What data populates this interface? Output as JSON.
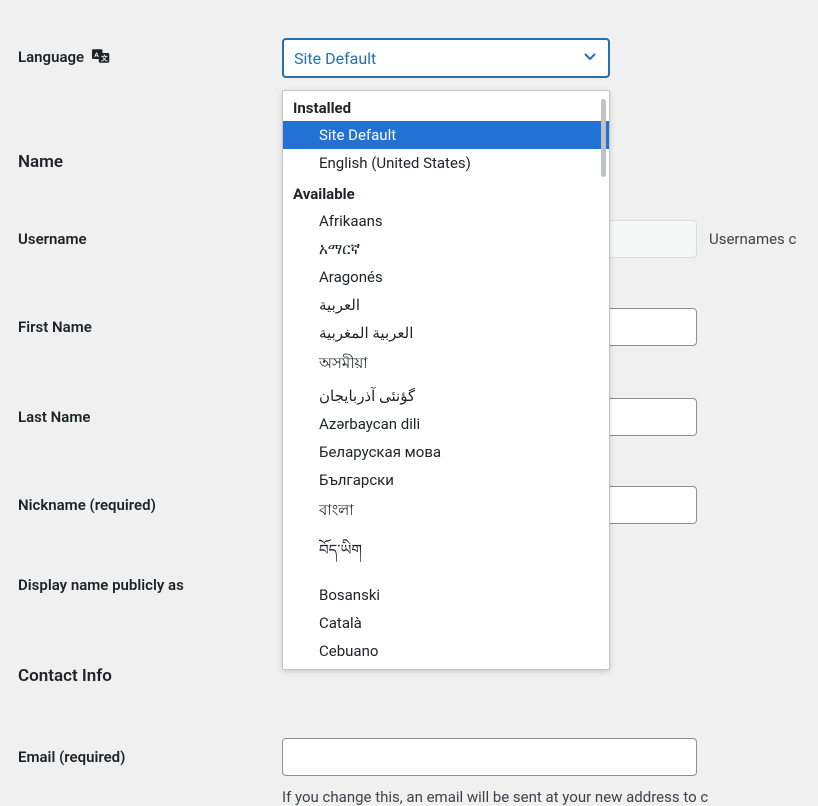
{
  "labels": {
    "language": "Language",
    "name": "Name",
    "username": "Username",
    "first_name": "First Name",
    "last_name": "Last Name",
    "nickname": "Nickname (required)",
    "display_name": "Display name publicly as",
    "contact_info": "Contact Info",
    "email": "Email (required)"
  },
  "language_select": {
    "current": "Site Default",
    "groups": [
      {
        "label": "Installed",
        "items": [
          "Site Default",
          "English (United States)"
        ]
      },
      {
        "label": "Available",
        "items": [
          "Afrikaans",
          "አማርኛ",
          "Aragonés",
          "العربية",
          "العربية المغربية",
          "অসমীয়া",
          "گؤنئی آذربایجان",
          "Azərbaycan dili",
          "Беларуская мова",
          "Български",
          "বাংলা",
          "བོད་ཡིག",
          "Bosanski",
          "Català",
          "Cebuano"
        ]
      }
    ],
    "selected": "Site Default"
  },
  "hints": {
    "username_right": "Usernames c",
    "email_below": "If you change this, an email will be sent at your new address to c"
  }
}
